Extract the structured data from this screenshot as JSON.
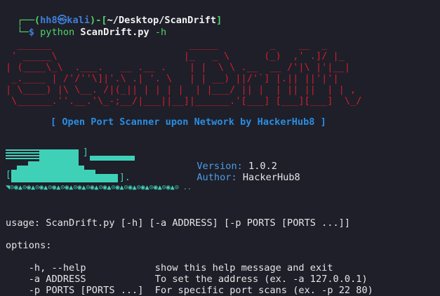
{
  "terminal": {
    "prompt": {
      "corner_top": "┌──(",
      "user": "hh8",
      "at_icon": "㉿",
      "host": "kali",
      "sep": ")-[",
      "path": "~/Desktop/ScanDrift",
      "close": "]",
      "corner_bottom": "└─",
      "dollar": "$ ",
      "command": "python",
      "script": "ScanDrift.py",
      "flag": "-h"
    },
    "banner_art": "  ______                        _____         _    __  _\n ' _____\\                      |_   _ \\      (_)  ,' .]/ |_\n| (____\\_\\  .___.   __ .__ .    | |  \\ \\ .__  __ /'|\\ |'|__|\n _.____ | /'/''\\]|'.\\ .| '. \\   | | __) ||/'`] |.|| ||'|'|\n| \\____) |\\ \\__. /|(_|| | | | |  | |___/ || |  | || ||  | | ,\n \\______.''.__.'\\_-;__/|___||__]|______.'[___] [___][___]  \\_/",
    "tagline": "[ Open Port Scanner upon Network by HackerHub8 ]",
    "version_label": "Version:",
    "version_value": "1.0.2",
    "author_label": "Author:",
    "author_value": "HackerHub8",
    "logo_icons": "◥⊙◉▲⊙◉▲⊙◉▲⊙◉▲⊙◉▲⊙◉▲⊙◉▲⊙◉▲⊙◉▲⊙◉▲⊙◉▲⊙◉▲⊙◉▲⊙ ..",
    "usage": "usage: ScanDrift.py [-h] [-a ADDRESS] [-p PORTS [PORTS ...]]",
    "options_header": "options:",
    "options": [
      {
        "flag": "  -h, --help           ",
        "desc": " show this help message and exit"
      },
      {
        "flag": "  -a ADDRESS           ",
        "desc": " To set the address (ex. -a 127.0.0.1)"
      },
      {
        "flag": "  -p PORTS [PORTS ...] ",
        "desc": " For specific port scans (ex. -p 22 80)"
      }
    ]
  }
}
